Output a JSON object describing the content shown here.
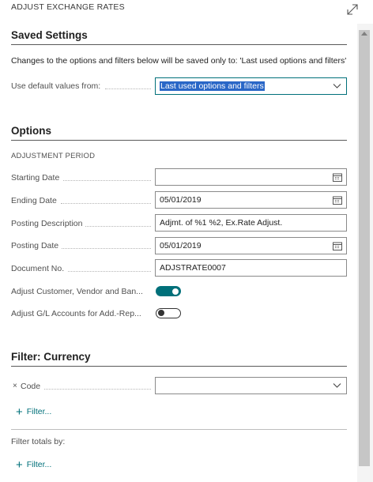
{
  "window": {
    "title": "ADJUST EXCHANGE RATES",
    "expand_icon": "expand-diagonal-icon"
  },
  "saved_settings": {
    "title": "Saved Settings",
    "info": "Changes to the options and filters below will be saved only to: 'Last used options and filters'",
    "default_label": "Use default values from:",
    "default_value": "Last used options and filters"
  },
  "options": {
    "title": "Options",
    "period_heading": "ADJUSTMENT PERIOD",
    "starting_date_label": "Starting Date",
    "starting_date_value": "",
    "ending_date_label": "Ending Date",
    "ending_date_value": "05/01/2019",
    "posting_description_label": "Posting Description",
    "posting_description_value": "Adjmt. of %1 %2, Ex.Rate Adjust.",
    "posting_date_label": "Posting Date",
    "posting_date_value": "05/01/2019",
    "document_no_label": "Document No.",
    "document_no_value": "ADJSTRATE0007",
    "adjust_cvb_label": "Adjust Customer, Vendor and Ban...",
    "adjust_cvb_on": true,
    "adjust_gl_label": "Adjust G/L Accounts for Add.-Rep...",
    "adjust_gl_on": false
  },
  "filter_currency": {
    "title": "Filter: Currency",
    "code_remove_mark": "×",
    "code_label": "Code",
    "code_value": "",
    "add_filter_label": "Filter..."
  },
  "filter_totals": {
    "label": "Filter totals by:",
    "add_filter_label": "Filter..."
  },
  "colors": {
    "accent": "#00707a",
    "selection": "#2a67c7"
  }
}
